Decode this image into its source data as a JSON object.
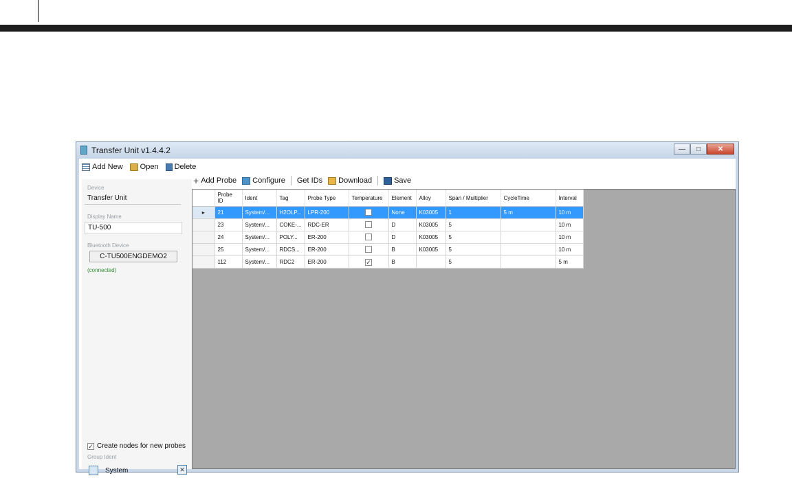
{
  "window": {
    "title": "Transfer Unit v1.4.4.2"
  },
  "main_toolbar": [
    {
      "label": "Add New",
      "icon": "add-new-icon"
    },
    {
      "label": "Open",
      "icon": "folder-icon"
    },
    {
      "label": "Delete",
      "icon": "trash-icon"
    }
  ],
  "sidebar": {
    "device_label": "Device",
    "device_value": "Transfer Unit",
    "display_name_label": "Display Name",
    "display_name_value": "TU-500",
    "bluetooth_label": "Bluetooth Device",
    "bluetooth_value": "C-TU500ENGDEMO2",
    "status": "(connected)",
    "create_nodes_label": "Create nodes for new probes",
    "create_nodes_checked": true,
    "group_ident_label": "Group Ident",
    "group_ident_value": "System"
  },
  "probe_toolbar": {
    "add_probe": "Add Probe",
    "configure": "Configure",
    "get_ids": "Get IDs",
    "download": "Download",
    "save": "Save"
  },
  "grid": {
    "columns": [
      "Probe ID",
      "Ident",
      "Tag",
      "Probe Type",
      "Temperature",
      "Element",
      "Alloy",
      "Span / Multiplier",
      "CycleTime",
      "Interval"
    ],
    "rows": [
      {
        "selected": true,
        "cells": [
          "21",
          "System/...",
          "H2OLP...",
          "LPR-200",
          "",
          "None",
          "K03005",
          "1",
          "5 m",
          "10 m"
        ],
        "temperature": false
      },
      {
        "selected": false,
        "cells": [
          "23",
          "System/...",
          "COKE-...",
          "RDC-ER",
          "",
          "D",
          "K03005",
          "5",
          "",
          "10 m"
        ],
        "temperature": false
      },
      {
        "selected": false,
        "cells": [
          "24",
          "System/...",
          "POLY...",
          "ER-200",
          "",
          "D",
          "K03005",
          "5",
          "",
          "10 m"
        ],
        "temperature": false
      },
      {
        "selected": false,
        "cells": [
          "25",
          "System/...",
          "RDCS...",
          "ER-200",
          "",
          "B",
          "K03005",
          "5",
          "",
          "10 m"
        ],
        "temperature": false
      },
      {
        "selected": false,
        "cells": [
          "112",
          "System/...",
          "RDC2",
          "ER-200",
          "",
          "B",
          "",
          "5",
          "",
          "5 m"
        ],
        "temperature": true
      }
    ]
  }
}
